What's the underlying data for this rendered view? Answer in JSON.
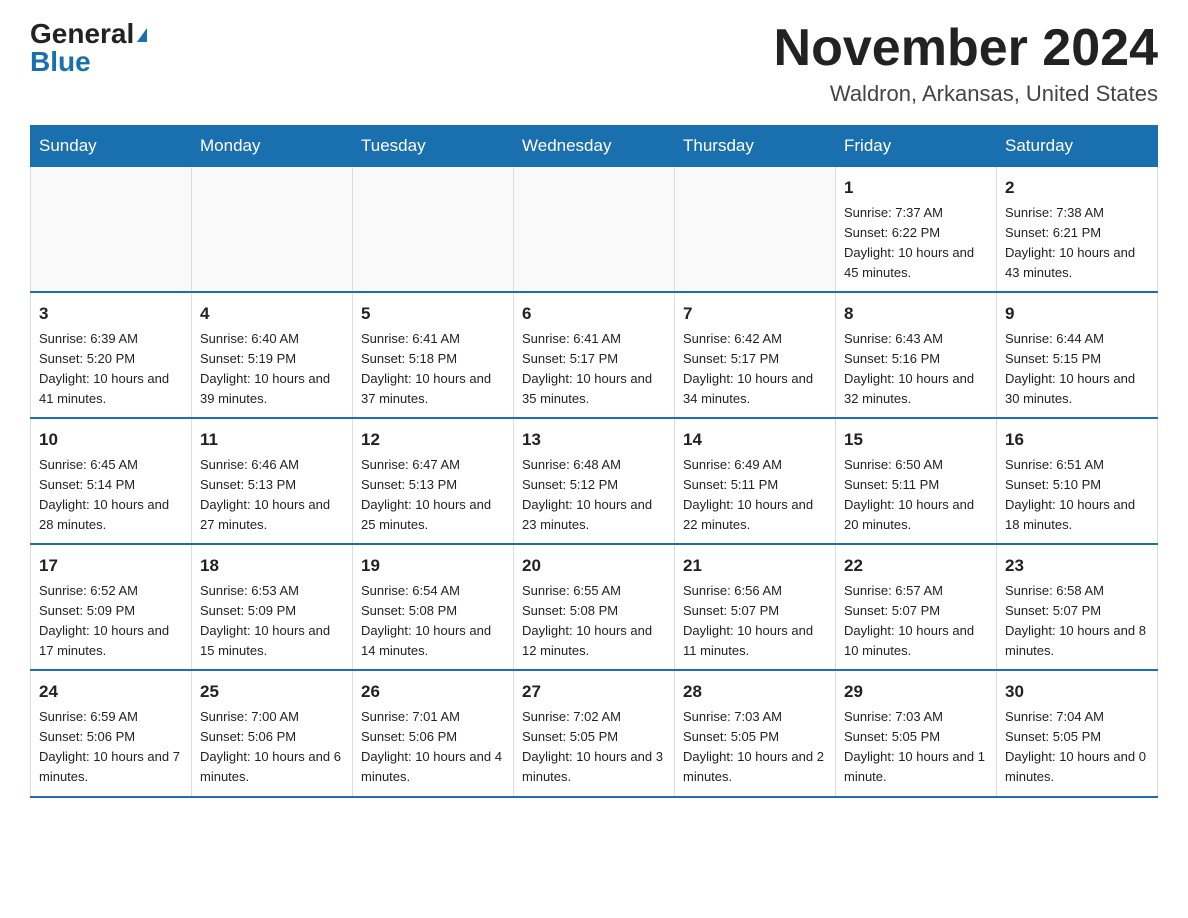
{
  "logo": {
    "general": "General",
    "blue": "Blue"
  },
  "header": {
    "month": "November 2024",
    "location": "Waldron, Arkansas, United States"
  },
  "weekdays": [
    "Sunday",
    "Monday",
    "Tuesday",
    "Wednesday",
    "Thursday",
    "Friday",
    "Saturday"
  ],
  "weeks": [
    [
      {
        "day": "",
        "sunrise": "",
        "sunset": "",
        "daylight": ""
      },
      {
        "day": "",
        "sunrise": "",
        "sunset": "",
        "daylight": ""
      },
      {
        "day": "",
        "sunrise": "",
        "sunset": "",
        "daylight": ""
      },
      {
        "day": "",
        "sunrise": "",
        "sunset": "",
        "daylight": ""
      },
      {
        "day": "",
        "sunrise": "",
        "sunset": "",
        "daylight": ""
      },
      {
        "day": "1",
        "sunrise": "Sunrise: 7:37 AM",
        "sunset": "Sunset: 6:22 PM",
        "daylight": "Daylight: 10 hours and 45 minutes."
      },
      {
        "day": "2",
        "sunrise": "Sunrise: 7:38 AM",
        "sunset": "Sunset: 6:21 PM",
        "daylight": "Daylight: 10 hours and 43 minutes."
      }
    ],
    [
      {
        "day": "3",
        "sunrise": "Sunrise: 6:39 AM",
        "sunset": "Sunset: 5:20 PM",
        "daylight": "Daylight: 10 hours and 41 minutes."
      },
      {
        "day": "4",
        "sunrise": "Sunrise: 6:40 AM",
        "sunset": "Sunset: 5:19 PM",
        "daylight": "Daylight: 10 hours and 39 minutes."
      },
      {
        "day": "5",
        "sunrise": "Sunrise: 6:41 AM",
        "sunset": "Sunset: 5:18 PM",
        "daylight": "Daylight: 10 hours and 37 minutes."
      },
      {
        "day": "6",
        "sunrise": "Sunrise: 6:41 AM",
        "sunset": "Sunset: 5:17 PM",
        "daylight": "Daylight: 10 hours and 35 minutes."
      },
      {
        "day": "7",
        "sunrise": "Sunrise: 6:42 AM",
        "sunset": "Sunset: 5:17 PM",
        "daylight": "Daylight: 10 hours and 34 minutes."
      },
      {
        "day": "8",
        "sunrise": "Sunrise: 6:43 AM",
        "sunset": "Sunset: 5:16 PM",
        "daylight": "Daylight: 10 hours and 32 minutes."
      },
      {
        "day": "9",
        "sunrise": "Sunrise: 6:44 AM",
        "sunset": "Sunset: 5:15 PM",
        "daylight": "Daylight: 10 hours and 30 minutes."
      }
    ],
    [
      {
        "day": "10",
        "sunrise": "Sunrise: 6:45 AM",
        "sunset": "Sunset: 5:14 PM",
        "daylight": "Daylight: 10 hours and 28 minutes."
      },
      {
        "day": "11",
        "sunrise": "Sunrise: 6:46 AM",
        "sunset": "Sunset: 5:13 PM",
        "daylight": "Daylight: 10 hours and 27 minutes."
      },
      {
        "day": "12",
        "sunrise": "Sunrise: 6:47 AM",
        "sunset": "Sunset: 5:13 PM",
        "daylight": "Daylight: 10 hours and 25 minutes."
      },
      {
        "day": "13",
        "sunrise": "Sunrise: 6:48 AM",
        "sunset": "Sunset: 5:12 PM",
        "daylight": "Daylight: 10 hours and 23 minutes."
      },
      {
        "day": "14",
        "sunrise": "Sunrise: 6:49 AM",
        "sunset": "Sunset: 5:11 PM",
        "daylight": "Daylight: 10 hours and 22 minutes."
      },
      {
        "day": "15",
        "sunrise": "Sunrise: 6:50 AM",
        "sunset": "Sunset: 5:11 PM",
        "daylight": "Daylight: 10 hours and 20 minutes."
      },
      {
        "day": "16",
        "sunrise": "Sunrise: 6:51 AM",
        "sunset": "Sunset: 5:10 PM",
        "daylight": "Daylight: 10 hours and 18 minutes."
      }
    ],
    [
      {
        "day": "17",
        "sunrise": "Sunrise: 6:52 AM",
        "sunset": "Sunset: 5:09 PM",
        "daylight": "Daylight: 10 hours and 17 minutes."
      },
      {
        "day": "18",
        "sunrise": "Sunrise: 6:53 AM",
        "sunset": "Sunset: 5:09 PM",
        "daylight": "Daylight: 10 hours and 15 minutes."
      },
      {
        "day": "19",
        "sunrise": "Sunrise: 6:54 AM",
        "sunset": "Sunset: 5:08 PM",
        "daylight": "Daylight: 10 hours and 14 minutes."
      },
      {
        "day": "20",
        "sunrise": "Sunrise: 6:55 AM",
        "sunset": "Sunset: 5:08 PM",
        "daylight": "Daylight: 10 hours and 12 minutes."
      },
      {
        "day": "21",
        "sunrise": "Sunrise: 6:56 AM",
        "sunset": "Sunset: 5:07 PM",
        "daylight": "Daylight: 10 hours and 11 minutes."
      },
      {
        "day": "22",
        "sunrise": "Sunrise: 6:57 AM",
        "sunset": "Sunset: 5:07 PM",
        "daylight": "Daylight: 10 hours and 10 minutes."
      },
      {
        "day": "23",
        "sunrise": "Sunrise: 6:58 AM",
        "sunset": "Sunset: 5:07 PM",
        "daylight": "Daylight: 10 hours and 8 minutes."
      }
    ],
    [
      {
        "day": "24",
        "sunrise": "Sunrise: 6:59 AM",
        "sunset": "Sunset: 5:06 PM",
        "daylight": "Daylight: 10 hours and 7 minutes."
      },
      {
        "day": "25",
        "sunrise": "Sunrise: 7:00 AM",
        "sunset": "Sunset: 5:06 PM",
        "daylight": "Daylight: 10 hours and 6 minutes."
      },
      {
        "day": "26",
        "sunrise": "Sunrise: 7:01 AM",
        "sunset": "Sunset: 5:06 PM",
        "daylight": "Daylight: 10 hours and 4 minutes."
      },
      {
        "day": "27",
        "sunrise": "Sunrise: 7:02 AM",
        "sunset": "Sunset: 5:05 PM",
        "daylight": "Daylight: 10 hours and 3 minutes."
      },
      {
        "day": "28",
        "sunrise": "Sunrise: 7:03 AM",
        "sunset": "Sunset: 5:05 PM",
        "daylight": "Daylight: 10 hours and 2 minutes."
      },
      {
        "day": "29",
        "sunrise": "Sunrise: 7:03 AM",
        "sunset": "Sunset: 5:05 PM",
        "daylight": "Daylight: 10 hours and 1 minute."
      },
      {
        "day": "30",
        "sunrise": "Sunrise: 7:04 AM",
        "sunset": "Sunset: 5:05 PM",
        "daylight": "Daylight: 10 hours and 0 minutes."
      }
    ]
  ]
}
